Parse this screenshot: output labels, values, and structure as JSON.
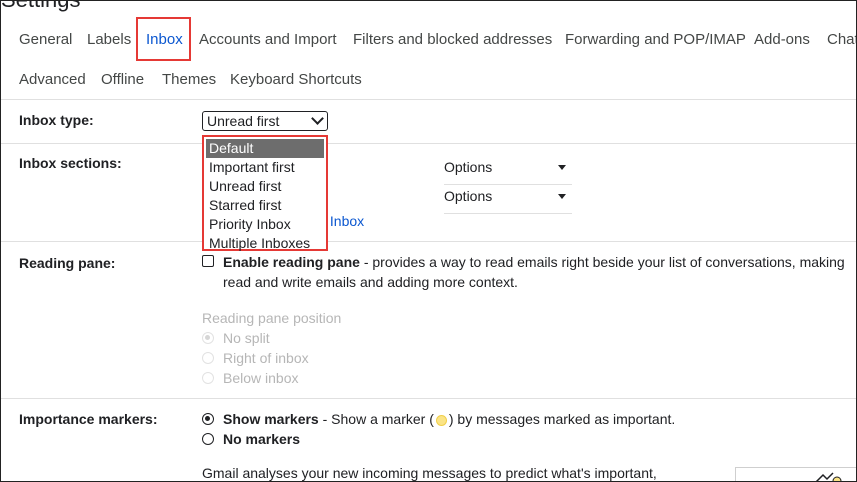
{
  "page_title": "Settings",
  "tabs_row1": [
    {
      "label": "General",
      "active": false
    },
    {
      "label": "Labels",
      "active": false
    },
    {
      "label": "Inbox",
      "active": true
    },
    {
      "label": "Accounts and Import",
      "active": false
    },
    {
      "label": "Filters and blocked addresses",
      "active": false
    },
    {
      "label": "Forwarding and POP/IMAP",
      "active": false
    },
    {
      "label": "Add-ons",
      "active": false
    },
    {
      "label": "Chat",
      "active": false
    }
  ],
  "tabs_row2": [
    {
      "label": "Advanced"
    },
    {
      "label": "Offline"
    },
    {
      "label": "Themes"
    },
    {
      "label": "Keyboard Shortcuts"
    }
  ],
  "inbox_type": {
    "label": "Inbox type:",
    "selected_value": "Unread first",
    "options": [
      "Default",
      "Important first",
      "Unread first",
      "Starred first",
      "Priority Inbox",
      "Multiple Inboxes"
    ],
    "highlighted_option": "Default"
  },
  "inbox_sections": {
    "label": "Inbox sections:",
    "options_labels": [
      "Options",
      "Options"
    ],
    "link_partial": "y Inbox"
  },
  "reading_pane": {
    "label": "Reading pane:",
    "enable_label": "Enable reading pane",
    "enable_desc_line1": " - provides a way to read emails right beside your list of conversations, making",
    "enable_desc_line2": "read and write emails and adding more context.",
    "position_heading": "Reading pane position",
    "positions": [
      "No split",
      "Right of inbox",
      "Below inbox"
    ]
  },
  "importance_markers": {
    "label": "Importance markers:",
    "show_label": "Show markers",
    "show_desc_before": " - Show a marker (",
    "show_desc_after": ") by messages marked as important.",
    "none_label": "No markers",
    "footer_text": "Gmail analyses your new incoming messages to predict what's important,"
  },
  "colors": {
    "accent": "#0b57d0",
    "highlight_border": "#e53935",
    "selected_option_bg": "#6d6d6d"
  }
}
